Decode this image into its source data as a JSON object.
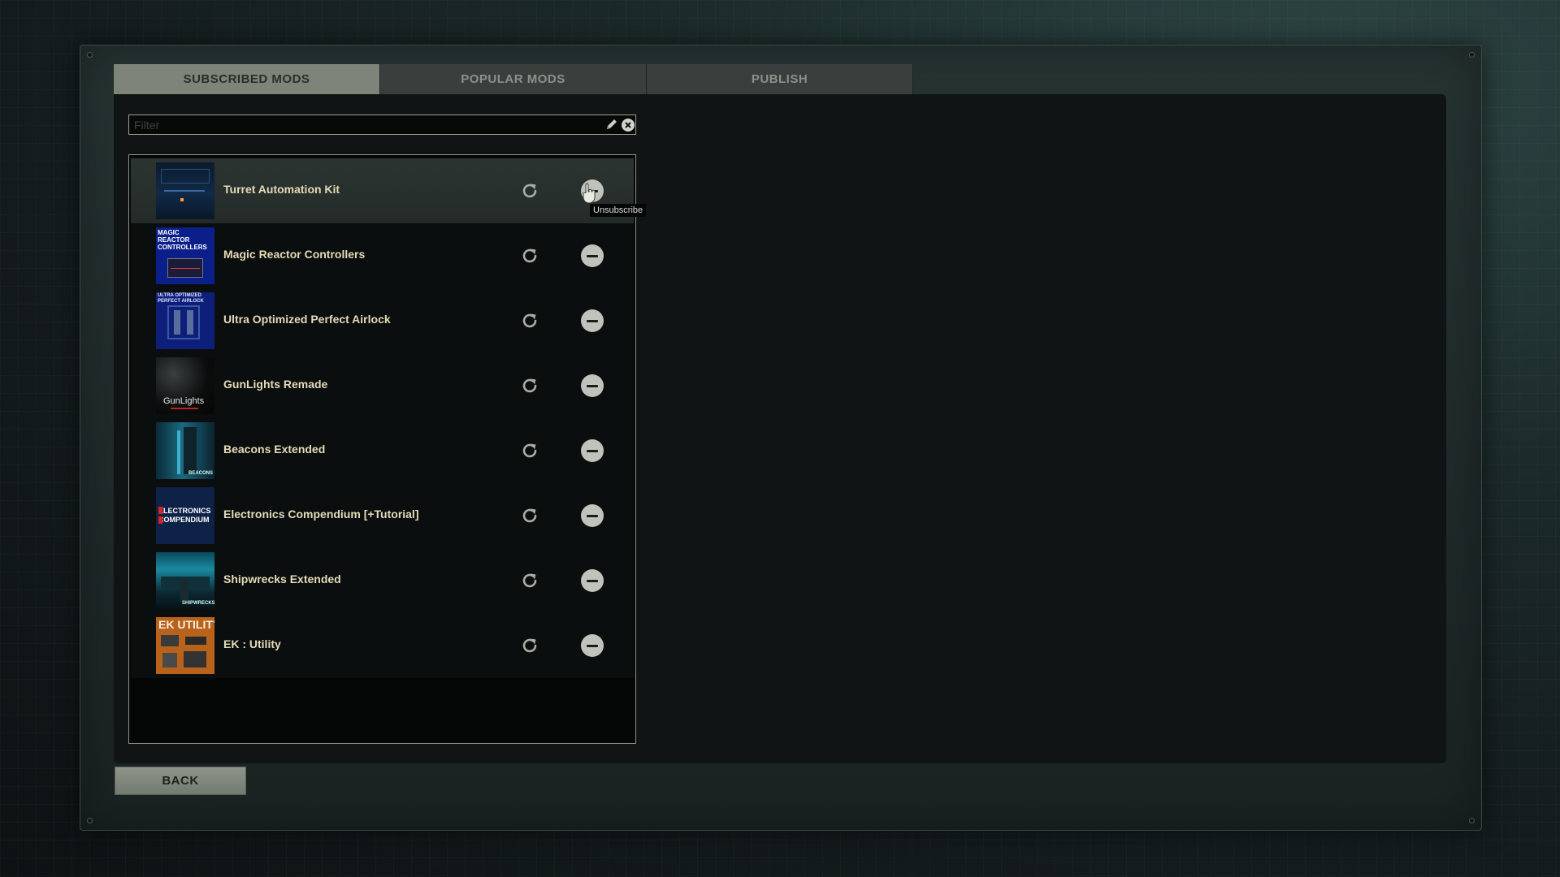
{
  "tabs": [
    {
      "label": "SUBSCRIBED MODS",
      "active": true
    },
    {
      "label": "POPULAR MODS",
      "active": false
    },
    {
      "label": "PUBLISH",
      "active": false
    }
  ],
  "search": {
    "value": "",
    "placeholder": "Filter"
  },
  "mods": [
    {
      "title": "Turret Automation Kit",
      "selected": true,
      "thumb_text": ""
    },
    {
      "title": "Magic Reactor Controllers",
      "selected": false,
      "thumb_text": "MAGIC REACTOR CONTROLLERS"
    },
    {
      "title": "Ultra Optimized Perfect Airlock",
      "selected": false,
      "thumb_text": "ULTRA OPTIMIZED PERFECT AIRLOCK"
    },
    {
      "title": "GunLights Remade",
      "selected": false,
      "thumb_text": "GunLights"
    },
    {
      "title": "Beacons Extended",
      "selected": false,
      "thumb_text": "BEACONS"
    },
    {
      "title": "Electronics Compendium [+Tutorial]",
      "selected": false,
      "thumb_text": "ELECTRONICS COMPENDIUM"
    },
    {
      "title": "Shipwrecks Extended",
      "selected": false,
      "thumb_text": "SHIPWRECKS"
    },
    {
      "title": "EK : Utility",
      "selected": false,
      "thumb_text": "EK UTILITY"
    }
  ],
  "tooltip": "Unsubscribe",
  "back_label": "BACK",
  "colors": {
    "mod_title": "#e4dbb7",
    "tab_active": "#7e8479",
    "tab_inactive": "#3a3f3d"
  }
}
